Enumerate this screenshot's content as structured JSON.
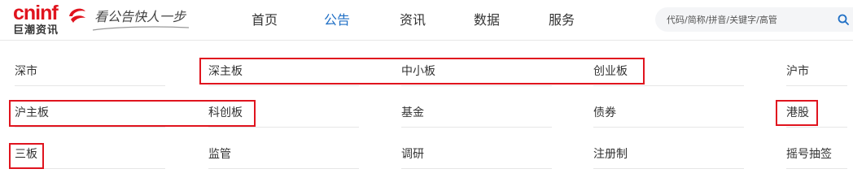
{
  "header": {
    "logo": {
      "word": "cninf",
      "sub": "巨潮资讯"
    },
    "slogan": "看公告快人一步",
    "nav": [
      {
        "label": "首页",
        "active": false
      },
      {
        "label": "公告",
        "active": true
      },
      {
        "label": "资讯",
        "active": false
      },
      {
        "label": "数据",
        "active": false
      },
      {
        "label": "服务",
        "active": false
      }
    ],
    "search": {
      "placeholder": "代码/简称/拼音/关键字/高管",
      "icon": "search-icon"
    }
  },
  "categories": {
    "rows": [
      [
        "深市",
        "深主板",
        "中小板",
        "创业板",
        "沪市"
      ],
      [
        "沪主板",
        "科创板",
        "基金",
        "债券",
        "港股"
      ],
      [
        "三板",
        "监管",
        "调研",
        "注册制",
        "摇号抽签"
      ]
    ],
    "highlighted": [
      "深主板",
      "中小板",
      "创业板",
      "沪主板",
      "科创板",
      "港股",
      "三板"
    ]
  },
  "colors": {
    "brand_red": "#e0141e",
    "nav_active": "#1f6fc5",
    "highlight_border": "#e0141e",
    "text": "#333333"
  }
}
